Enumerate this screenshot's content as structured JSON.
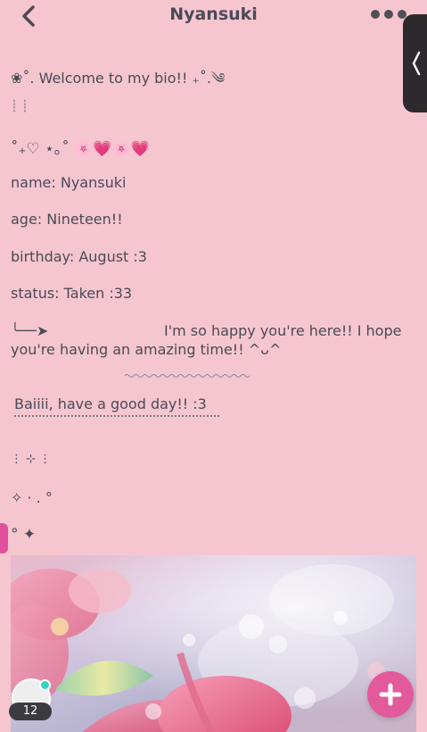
{
  "header": {
    "title": "Nyansuki"
  },
  "bio": {
    "welcome": "❀˚. Welcome to my bio!! ₊˚.༄",
    "divider1": "┊         ┊",
    "hearts_line": "˚₊♡ ⋆｡˚ 🌸💗🌸💗",
    "name": "name: Nyansuki",
    "age": "age: Nineteen!!",
    "birthday": "birthday: August :3",
    "status": "status: Taken :33",
    "arrow": "╰──➤",
    "message": "I'm so happy you're here!! I hope you're having an amazing time!! ^ᴗ^",
    "goodbye": "Baiiii, have a good day!! :3",
    "divider2": "⋮ ⊹        ⋮",
    "sparkle_line": "✧ ·       . °",
    "star_line": "° ✦"
  },
  "footer": {
    "comment_count": "12"
  },
  "colors": {
    "background": "#f6c6d0",
    "accent": "#e25a9c",
    "side_tab": "#2d2a2e"
  }
}
